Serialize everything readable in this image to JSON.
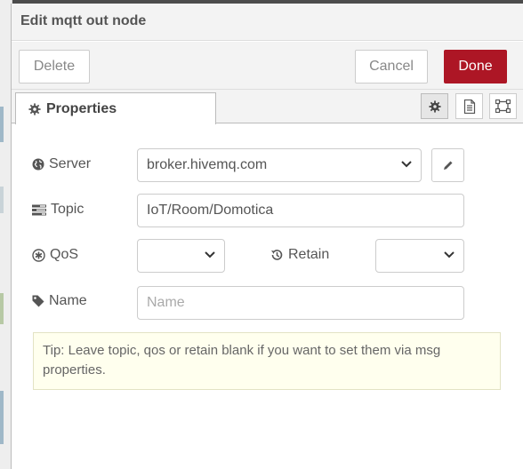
{
  "dialog": {
    "title": "Edit mqtt out node"
  },
  "toolbar": {
    "delete_label": "Delete",
    "cancel_label": "Cancel",
    "done_label": "Done"
  },
  "tabs": {
    "properties_label": "Properties",
    "icons": [
      "gear-icon",
      "document-icon",
      "frame-icon"
    ]
  },
  "form": {
    "server": {
      "label": "Server",
      "value": "broker.hivemq.com",
      "icon": "globe-icon"
    },
    "topic": {
      "label": "Topic",
      "value": "IoT/Room/Domotica",
      "icon": "tasks-icon"
    },
    "qos": {
      "label": "QoS",
      "value": "",
      "icon": "asterisk-circle-icon"
    },
    "retain": {
      "label": "Retain",
      "value": "",
      "icon": "history-icon"
    },
    "name": {
      "label": "Name",
      "value": "",
      "placeholder": "Name",
      "icon": "tag-icon"
    }
  },
  "tip": {
    "text": "Tip: Leave topic, qos or retain blank if you want to set them via msg properties."
  },
  "colors": {
    "done_button": "#ad1625",
    "tip_background": "#ffffee",
    "header_background": "#f3f3f3"
  }
}
